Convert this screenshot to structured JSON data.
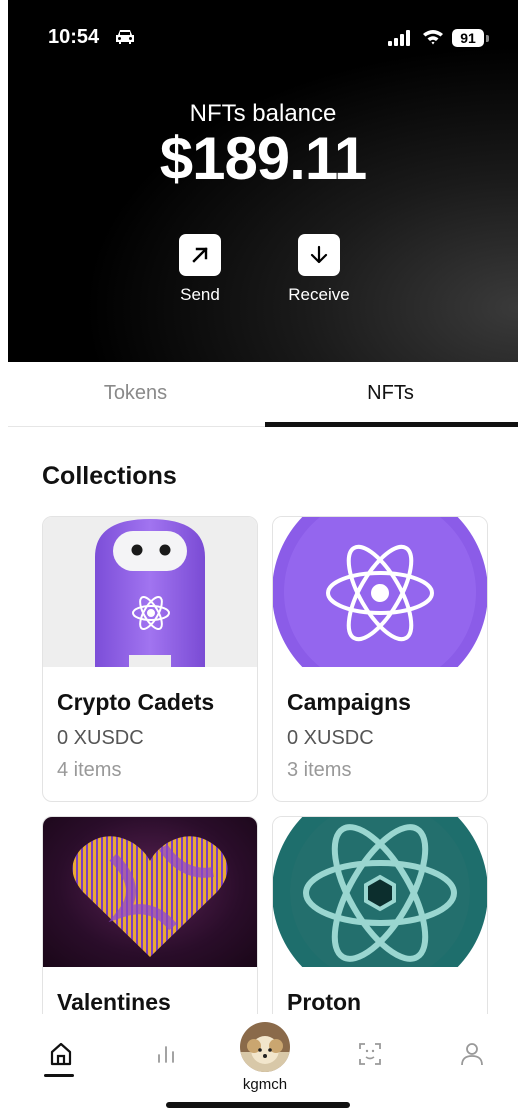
{
  "status_bar": {
    "time": "10:54",
    "battery": "91"
  },
  "balance": {
    "label": "NFTs balance",
    "value": "$189.11"
  },
  "actions": [
    {
      "label": "Send",
      "icon": "arrow-up-right-icon"
    },
    {
      "label": "Receive",
      "icon": "arrow-down-icon"
    }
  ],
  "tabs": [
    {
      "label": "Tokens",
      "active": false
    },
    {
      "label": "NFTs",
      "active": true
    }
  ],
  "collections": {
    "title": "Collections",
    "items": [
      {
        "name": "Crypto Cadets",
        "value": "0 XUSDC",
        "count": "4 items"
      },
      {
        "name": "Campaigns",
        "value": "0 XUSDC",
        "count": "3 items"
      },
      {
        "name": "Valentines"
      },
      {
        "name": "Proton"
      }
    ]
  },
  "bottom_nav": {
    "username": "kgmch",
    "items": [
      "home-icon",
      "chart-icon",
      "avatar",
      "scan-icon",
      "user-icon"
    ]
  },
  "colors": {
    "hero_bg": "#000000",
    "purple": "#8a5ce8",
    "teal": "#2a8a86"
  }
}
